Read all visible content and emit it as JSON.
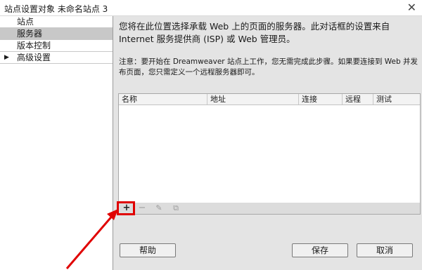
{
  "window": {
    "title": "站点设置对象 未命名站点 3",
    "close_label": "✕"
  },
  "sidebar": {
    "items": [
      {
        "label": "站点",
        "selected": false,
        "has_arrow": false
      },
      {
        "label": "服务器",
        "selected": true,
        "has_arrow": false
      },
      {
        "label": "版本控制",
        "selected": false,
        "has_arrow": false
      },
      {
        "label": "高级设置",
        "selected": false,
        "has_arrow": true
      }
    ],
    "expand_arrow": "▶"
  },
  "main": {
    "intro_text": "您将在此位置选择承载 Web 上的页面的服务器。此对话框的设置来自 Internet 服务提供商 (ISP) 或 Web 管理员。",
    "note_text": "注意：要开始在 Dreamweaver 站点上工作，您无需完成此步骤。如果要连接到 Web 并发布页面，您只需定义一个远程服务器即可。",
    "table": {
      "columns": [
        "名称",
        "地址",
        "连接",
        "远程",
        "测试"
      ],
      "rows": []
    },
    "toolbar": {
      "add": "+",
      "remove": "−",
      "edit": "✎",
      "duplicate": "⧉"
    }
  },
  "footer": {
    "help_label": "帮助",
    "save_label": "保存",
    "cancel_label": "取消"
  },
  "colors": {
    "annotation": "#e00000",
    "panel_bg": "#e4e4e4",
    "selected_bg": "#c8c8c8"
  }
}
